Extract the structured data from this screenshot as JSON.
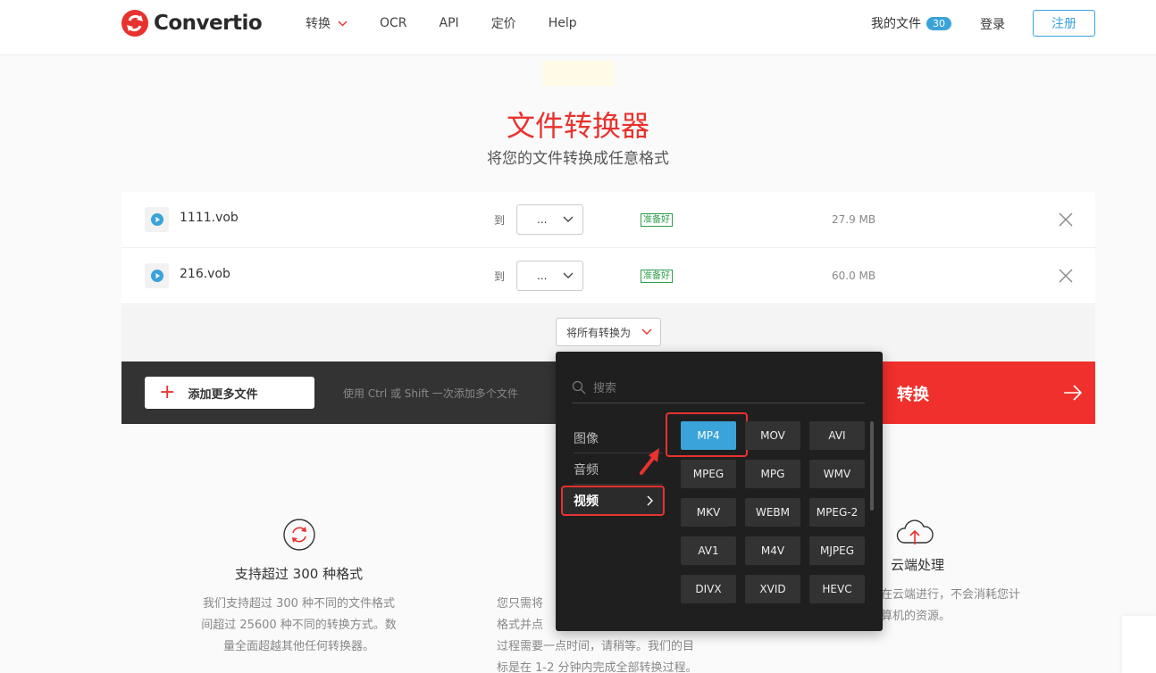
{
  "header": {
    "brand": "Convertio",
    "nav": [
      "转换",
      "OCR",
      "API",
      "定价",
      "Help"
    ],
    "my_files": "我的文件",
    "files_count": "30",
    "login": "登录",
    "signup": "注册"
  },
  "hero": {
    "title": "文件转换器",
    "subtitle": "将您的文件转换成任意格式"
  },
  "files": [
    {
      "name": "1111.vob",
      "to": "到",
      "format": "...",
      "status": "准备好",
      "size": "27.9 MB"
    },
    {
      "name": "216.vob",
      "to": "到",
      "format": "...",
      "status": "准备好",
      "size": "60.0 MB"
    }
  ],
  "convert_all": "将所有转换为",
  "actions": {
    "add_more": "添加更多文件",
    "hint": "使用 Ctrl 或 Shift 一次添加多个文件",
    "convert": "转换"
  },
  "dropdown": {
    "search_placeholder": "搜索",
    "categories": [
      "图像",
      "音频",
      "视频"
    ],
    "formats": [
      "MP4",
      "MOV",
      "AVI",
      "MPEG",
      "MPG",
      "WMV",
      "MKV",
      "WEBM",
      "MPEG-2",
      "AV1",
      "M4V",
      "MJPEG",
      "DIVX",
      "XVID",
      "HEVC"
    ]
  },
  "features": [
    {
      "title": "支持超过 300 种格式",
      "lines": [
        "我们支持超过 300 种不同的文件格式",
        "间超过 25600 种不同的转换方式。数",
        "量全面超越其他任何转换器。"
      ]
    },
    {
      "title": "",
      "lines": [
        "您只需将",
        "格式并点",
        "过程需要一点时间，请稍等。我们的目",
        "标是在 1-2 分钟内完成全部转换过程。"
      ]
    },
    {
      "title": "云端处理",
      "lines": [
        "在云端进行，不会消耗您计",
        "算机的资源。"
      ]
    }
  ],
  "colors": {
    "brand_red": "#e8322e",
    "accent_blue": "#3aa3d9",
    "ready_green": "#2e9d4a",
    "dark_bar": "#333333",
    "dropdown_bg": "#1f1f1f"
  },
  "icons": {
    "file": "play-circle-icon",
    "remove": "close-icon",
    "search": "search-icon",
    "convert": "arrow-right-icon",
    "feature1": "refresh-icon",
    "feature3": "cloud-upload-icon"
  }
}
